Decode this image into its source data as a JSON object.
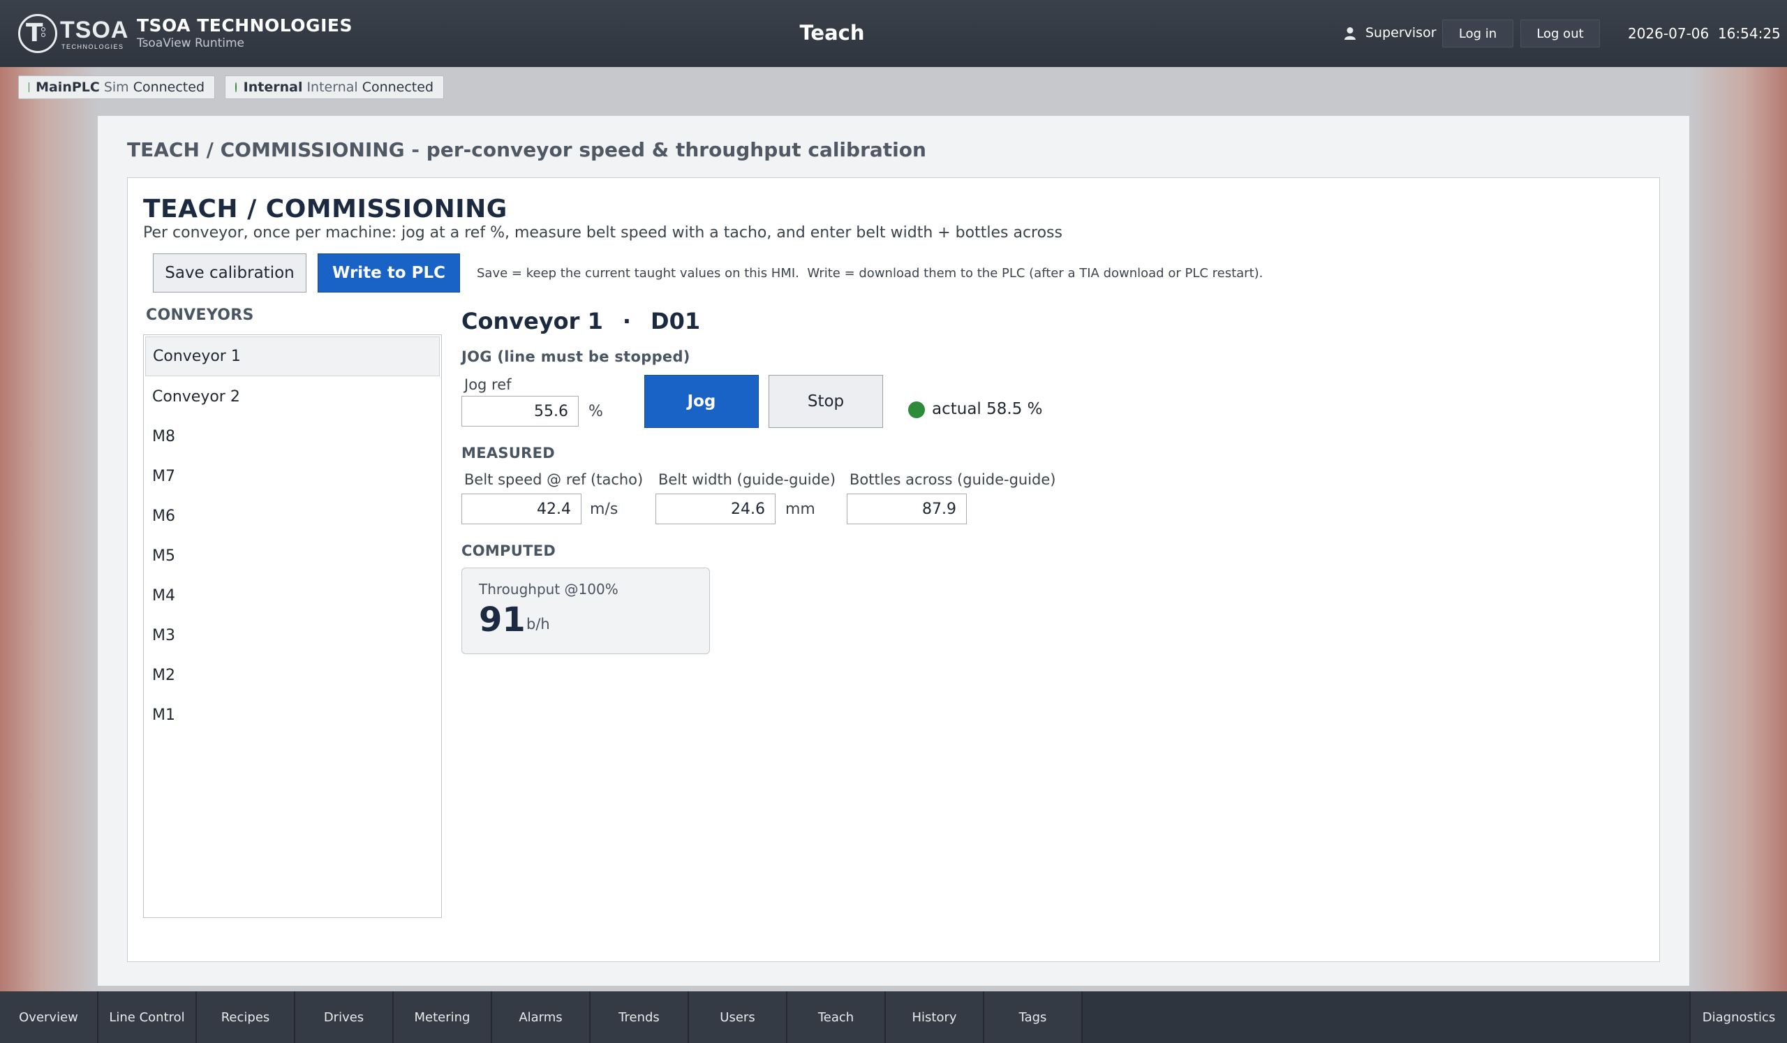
{
  "header": {
    "logo_word": "TSOA",
    "logo_sub": "TECHNOLOGIES",
    "brand_title": "TSOA TECHNOLOGIES",
    "brand_sub": "TsoaView Runtime",
    "page_title": "Teach",
    "user": "Supervisor",
    "login_label": "Log in",
    "logout_label": "Log out",
    "datetime": "2026-07-06  16:54:25"
  },
  "connections": [
    {
      "name": "MainPLC",
      "kind": "Sim",
      "status": "Connected",
      "color": "#2e8b3a"
    },
    {
      "name": "Internal",
      "kind": "Internal",
      "status": "Connected",
      "color": "#2e8b3a"
    }
  ],
  "panel": {
    "title_main": "TEACH / COMMISSIONING",
    "title_sep": " - ",
    "title_sub": "per-conveyor speed & throughput calibration"
  },
  "teach": {
    "heading": "TEACH / COMMISSIONING",
    "lead": "Per conveyor, once per machine: jog at a ref %, measure belt speed with a tacho, and enter belt width + bottles across",
    "save_label": "Save calibration",
    "write_label": "Write to PLC",
    "hint": "Save = keep the current taught values on this HMI.  Write = download them to the PLC (after a TIA download or PLC restart).",
    "conveyors_label": "CONVEYORS",
    "conveyors": [
      "Conveyor 1",
      "Conveyor 2",
      "M8",
      "M7",
      "M6",
      "M5",
      "M4",
      "M3",
      "M2",
      "M1"
    ],
    "selected_index": 0
  },
  "detail": {
    "name": "Conveyor 1",
    "sep": "·",
    "code": "D01",
    "jog_label": "JOG (line must be stopped)",
    "jog_ref_caption": "Jog ref",
    "jog_ref_value": "55.6",
    "jog_ref_unit": "%",
    "jog_button": "Jog",
    "stop_button": "Stop",
    "actual_text": "actual 58.5 %",
    "status_color": "#2e8b3a",
    "measured_label": "MEASURED",
    "belt_speed_caption": "Belt speed @ ref (tacho)",
    "belt_speed_value": "42.4",
    "belt_speed_unit": "m/s",
    "belt_width_caption": "Belt width (guide-guide)",
    "belt_width_value": "24.6",
    "belt_width_unit": "mm",
    "bottles_caption": "Bottles across (guide-guide)",
    "bottles_value": "87.9",
    "computed_label": "COMPUTED",
    "throughput_caption": "Throughput @100%",
    "throughput_value": "91",
    "throughput_unit": "b/h"
  },
  "nav": {
    "items": [
      "Overview",
      "Line Control",
      "Recipes",
      "Drives",
      "Metering",
      "Alarms",
      "Trends",
      "Users",
      "Teach",
      "History",
      "Tags"
    ],
    "diagnostics": "Diagnostics",
    "active": "Teach"
  },
  "colors": {
    "accent": "#1a63c6",
    "ok": "#2e8b3a",
    "header_bg": "#2f353e"
  }
}
